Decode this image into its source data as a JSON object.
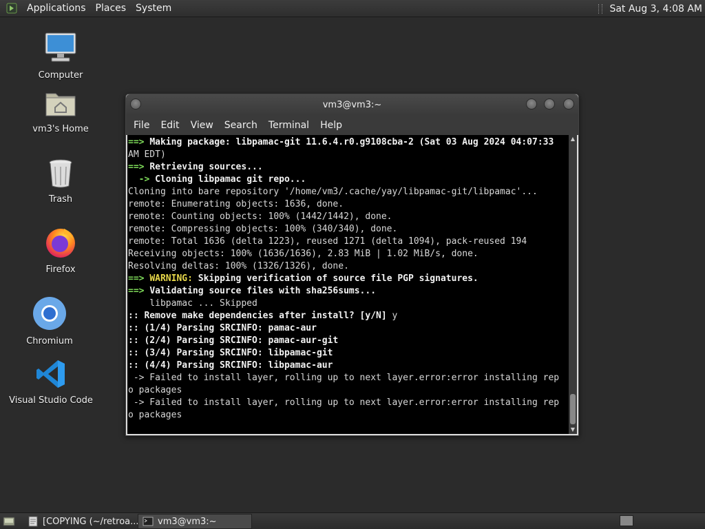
{
  "top_panel": {
    "menus": [
      "Applications",
      "Places",
      "System"
    ],
    "clock": "Sat Aug  3,  4:08 AM"
  },
  "desktop_icons": [
    {
      "label": "Computer",
      "icon": "computer-icon"
    },
    {
      "label": "vm3's Home",
      "icon": "home-folder-icon"
    },
    {
      "label": "Trash",
      "icon": "trash-icon"
    },
    {
      "label": "Firefox",
      "icon": "firefox-icon"
    },
    {
      "label": "Chromium",
      "icon": "chromium-icon"
    },
    {
      "label": "Visual Studio Code",
      "icon": "vscode-icon"
    }
  ],
  "terminal": {
    "title": "vm3@vm3:~",
    "menu": [
      "File",
      "Edit",
      "View",
      "Search",
      "Terminal",
      "Help"
    ],
    "lines": [
      [
        "==> ",
        "Making package: libpamac-git 11.6.4.r0.g9108cba-2 (Sat 03 Aug 2024 04:07:33"
      ],
      [
        "",
        "AM EDT)"
      ],
      [
        "==> ",
        "Retrieving sources..."
      ],
      [
        "  -> ",
        "Cloning libpamac git repo..."
      ],
      [
        "",
        "Cloning into bare repository '/home/vm3/.cache/yay/libpamac-git/libpamac'..."
      ],
      [
        "",
        "remote: Enumerating objects: 1636, done."
      ],
      [
        "",
        "remote: Counting objects: 100% (1442/1442), done."
      ],
      [
        "",
        "remote: Compressing objects: 100% (340/340), done."
      ],
      [
        "",
        "remote: Total 1636 (delta 1223), reused 1271 (delta 1094), pack-reused 194"
      ],
      [
        "",
        "Receiving objects: 100% (1636/1636), 2.83 MiB | 1.02 MiB/s, done."
      ],
      [
        "",
        "Resolving deltas: 100% (1326/1326), done."
      ],
      [
        "==> ",
        "WARNING:",
        " Skipping verification of source file PGP signatures."
      ],
      [
        "==> ",
        "Validating source files with sha256sums..."
      ],
      [
        "",
        "    libpamac ... Skipped"
      ],
      [
        ":: ",
        "Remove make dependencies after install? [y/N]",
        " y"
      ],
      [
        ":: ",
        "(1/4) Parsing SRCINFO: pamac-aur"
      ],
      [
        ":: ",
        "(2/4) Parsing SRCINFO: pamac-aur-git"
      ],
      [
        ":: ",
        "(3/4) Parsing SRCINFO: libpamac-git"
      ],
      [
        ":: ",
        "(4/4) Parsing SRCINFO: libpamac-aur"
      ],
      [
        "",
        " -> Failed to install layer, rolling up to next layer.error:error installing rep"
      ],
      [
        "",
        "o packages"
      ],
      [
        "",
        " -> Failed to install layer, rolling up to next layer.error:error installing rep"
      ],
      [
        "",
        "o packages"
      ]
    ]
  },
  "taskbar": {
    "tasks": [
      {
        "label": "[COPYING (~/retroa...",
        "active": false
      },
      {
        "label": "vm3@vm3:~",
        "active": true
      }
    ]
  },
  "colors": {
    "arrow_green": "#7fdc5a",
    "warning_yellow": "#e8d84a",
    "terminal_bg": "#000000",
    "desktop_bg": "#2b2b2b"
  }
}
